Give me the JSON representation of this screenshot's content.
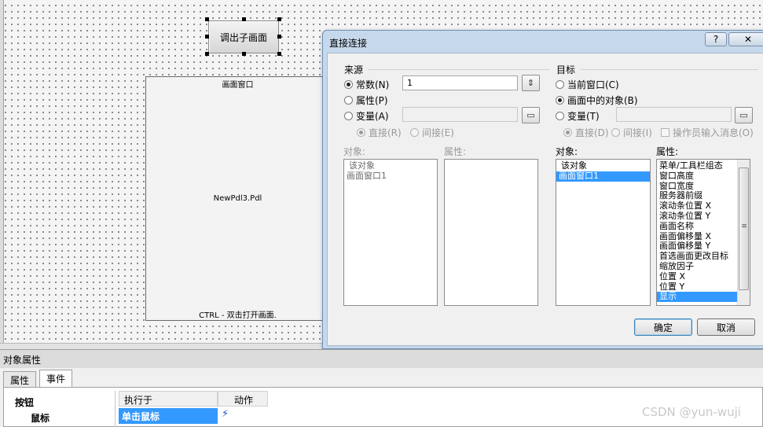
{
  "canvas": {
    "button_label": "调出子画面",
    "picture_window": {
      "title": "画面窗口",
      "file": "NewPdl3.Pdl",
      "hint": "CTRL - 双击打开画面."
    }
  },
  "dialog": {
    "title": "直接连接",
    "help_label": "?",
    "close_label": "✕",
    "source": {
      "title": "来源",
      "constant_label": "常数(N)",
      "constant_value": "1",
      "property_label": "属性(P)",
      "variable_label": "变量(A)",
      "direct_label": "直接(R)",
      "indirect_label": "间接(E)",
      "object_label": "对象:",
      "attribute_label": "属性:",
      "objects": [
        "该对象",
        "画面窗口1"
      ],
      "attributes": []
    },
    "target": {
      "title": "目标",
      "current_window_label": "当前窗口(C)",
      "object_in_picture_label": "画面中的对象(B)",
      "variable_label": "变量(T)",
      "direct_label": "直接(D)",
      "indirect_label": "间接(I)",
      "operator_msg_label": "操作员输入消息(O)",
      "object_label": "对象:",
      "attribute_label": "属性:",
      "objects": [
        "该对象",
        "画面窗口1"
      ],
      "selected_object": "画面窗口1",
      "attributes": [
        "菜单/工具栏组态",
        "窗口高度",
        "窗口宽度",
        "服务器前缀",
        "滚动条位置 X",
        "滚动条位置 Y",
        "画面名称",
        "画面偏移量 X",
        "画面偏移量 Y",
        "首选画面更改目标",
        "缩放因子",
        "位置 X",
        "位置 Y",
        "显示"
      ],
      "selected_attribute": "显示"
    },
    "ok_label": "确定",
    "cancel_label": "取消"
  },
  "properties_panel": {
    "title": "对象属性",
    "tabs": [
      "属性",
      "事件"
    ],
    "active_tab": "事件",
    "tree": {
      "root": "按钮",
      "child": "鼠标"
    },
    "columns": [
      "执行于",
      "动作"
    ],
    "rows": [
      {
        "event": "单击鼠标",
        "action": "lightning-icon"
      }
    ]
  },
  "watermark": "CSDN @yun-wuji",
  "colors": {
    "selection": "#3399ff",
    "dialog_frame": "#c6d8ec"
  }
}
